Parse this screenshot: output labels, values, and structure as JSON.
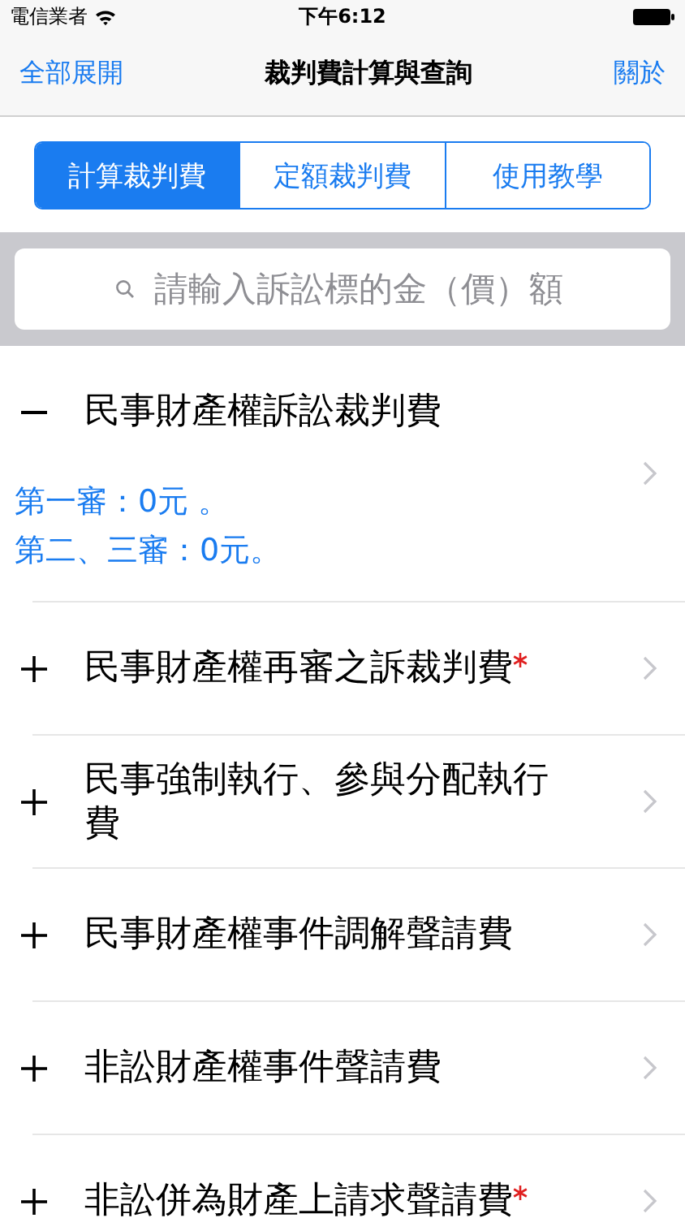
{
  "status_bar": {
    "carrier": "電信業者",
    "time": "下午6:12"
  },
  "nav": {
    "left_button": "全部展開",
    "title": "裁判費計算與查詢",
    "right_button": "關於"
  },
  "tabs": [
    {
      "label": "計算裁判費",
      "selected": true
    },
    {
      "label": "定額裁判費",
      "selected": false
    },
    {
      "label": "使用教學",
      "selected": false
    }
  ],
  "search": {
    "placeholder": "請輸入訴訟標的金（價）額"
  },
  "items": [
    {
      "title": "民事財產權訴訟裁判費",
      "required": false,
      "expanded": true,
      "details": [
        "第一審：0元 。",
        "第二、三審：0元。"
      ]
    },
    {
      "title": "民事財產權再審之訴裁判費",
      "required": true,
      "expanded": false
    },
    {
      "title": "民事強制執行、參與分配執行費",
      "required": false,
      "expanded": false
    },
    {
      "title": "民事財產權事件調解聲請費",
      "required": false,
      "expanded": false
    },
    {
      "title": "非訟財產權事件聲請費",
      "required": false,
      "expanded": false
    },
    {
      "title": "非訟併為財產上請求聲請費",
      "required": true,
      "expanded": false
    }
  ]
}
